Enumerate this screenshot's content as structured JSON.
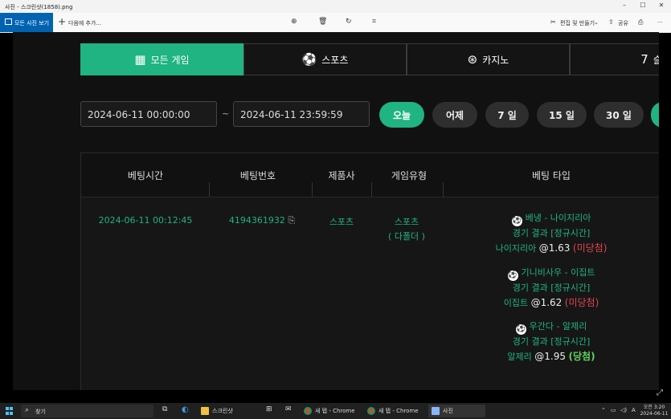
{
  "window": {
    "title": "사진 - 스크린샷(1858).png",
    "minimize": "–",
    "maximize": "☐",
    "close": "✕"
  },
  "toolbar": {
    "all_photos": "모든 사진 보기",
    "add_to": "다음에 추가...",
    "edit_create": "편집 및 만들기",
    "share": "공유",
    "more": "···"
  },
  "site": {
    "tabs": [
      {
        "label": "모든 게임",
        "icon": "grid-icon",
        "active": true
      },
      {
        "label": "스포츠",
        "icon": "soccer-ball-icon",
        "active": false
      },
      {
        "label": "카지노",
        "icon": "casino-chip-icon",
        "active": false
      },
      {
        "label": "슬",
        "icon": "slot-machine-icon",
        "active": false
      }
    ],
    "filters": {
      "start": "2024-06-11 00:00:00",
      "tilde": "~",
      "end": "2024-06-11 23:59:59",
      "buttons": [
        "오늘",
        "어제",
        "7 일",
        "15 일",
        "30 일"
      ]
    },
    "table": {
      "headers": [
        "베팅시간",
        "베팅번호",
        "제품사",
        "게임유형",
        "베팅 타입"
      ],
      "row": {
        "time": "2024-06-11 00:12:45",
        "bet_no": "4194361932",
        "provider": "스포츠",
        "game_type": "스포츠",
        "game_sub": "( 다폴더 )",
        "bets": [
          {
            "match": "베냉 - 나이지리아",
            "market": "경기 결과 [정규시간]",
            "pick": "나이지리아",
            "odds": "@1.63",
            "result": "(미당첨)",
            "status": "lost"
          },
          {
            "match": "기니비사우 - 이집트",
            "market": "경기 결과 [정규시간]",
            "pick": "이집트",
            "odds": "@1.62",
            "result": "(미당첨)",
            "status": "lost"
          },
          {
            "match": "우간다 - 알제리",
            "market": "경기 결과 [정규시간]",
            "pick": "알제리",
            "odds": "@1.95",
            "result": "(당첨)",
            "status": "won"
          }
        ]
      }
    }
  },
  "taskbar": {
    "search": "찾기",
    "apps": [
      {
        "label": "스크린샷",
        "icon": "folder-icon"
      },
      {
        "label": "새 탭 - Chrome",
        "icon": "chrome-icon"
      },
      {
        "label": "새 탭 - Chrome",
        "icon": "chrome-icon"
      },
      {
        "label": "사진",
        "icon": "photos-icon"
      }
    ],
    "time": "오전 3:20",
    "date": "2024-06-11",
    "lang": "A"
  },
  "colors": {
    "accent": "#1fb482",
    "lost": "#e0454f",
    "won": "#5fd45f",
    "photos_blue": "#0063b1"
  }
}
